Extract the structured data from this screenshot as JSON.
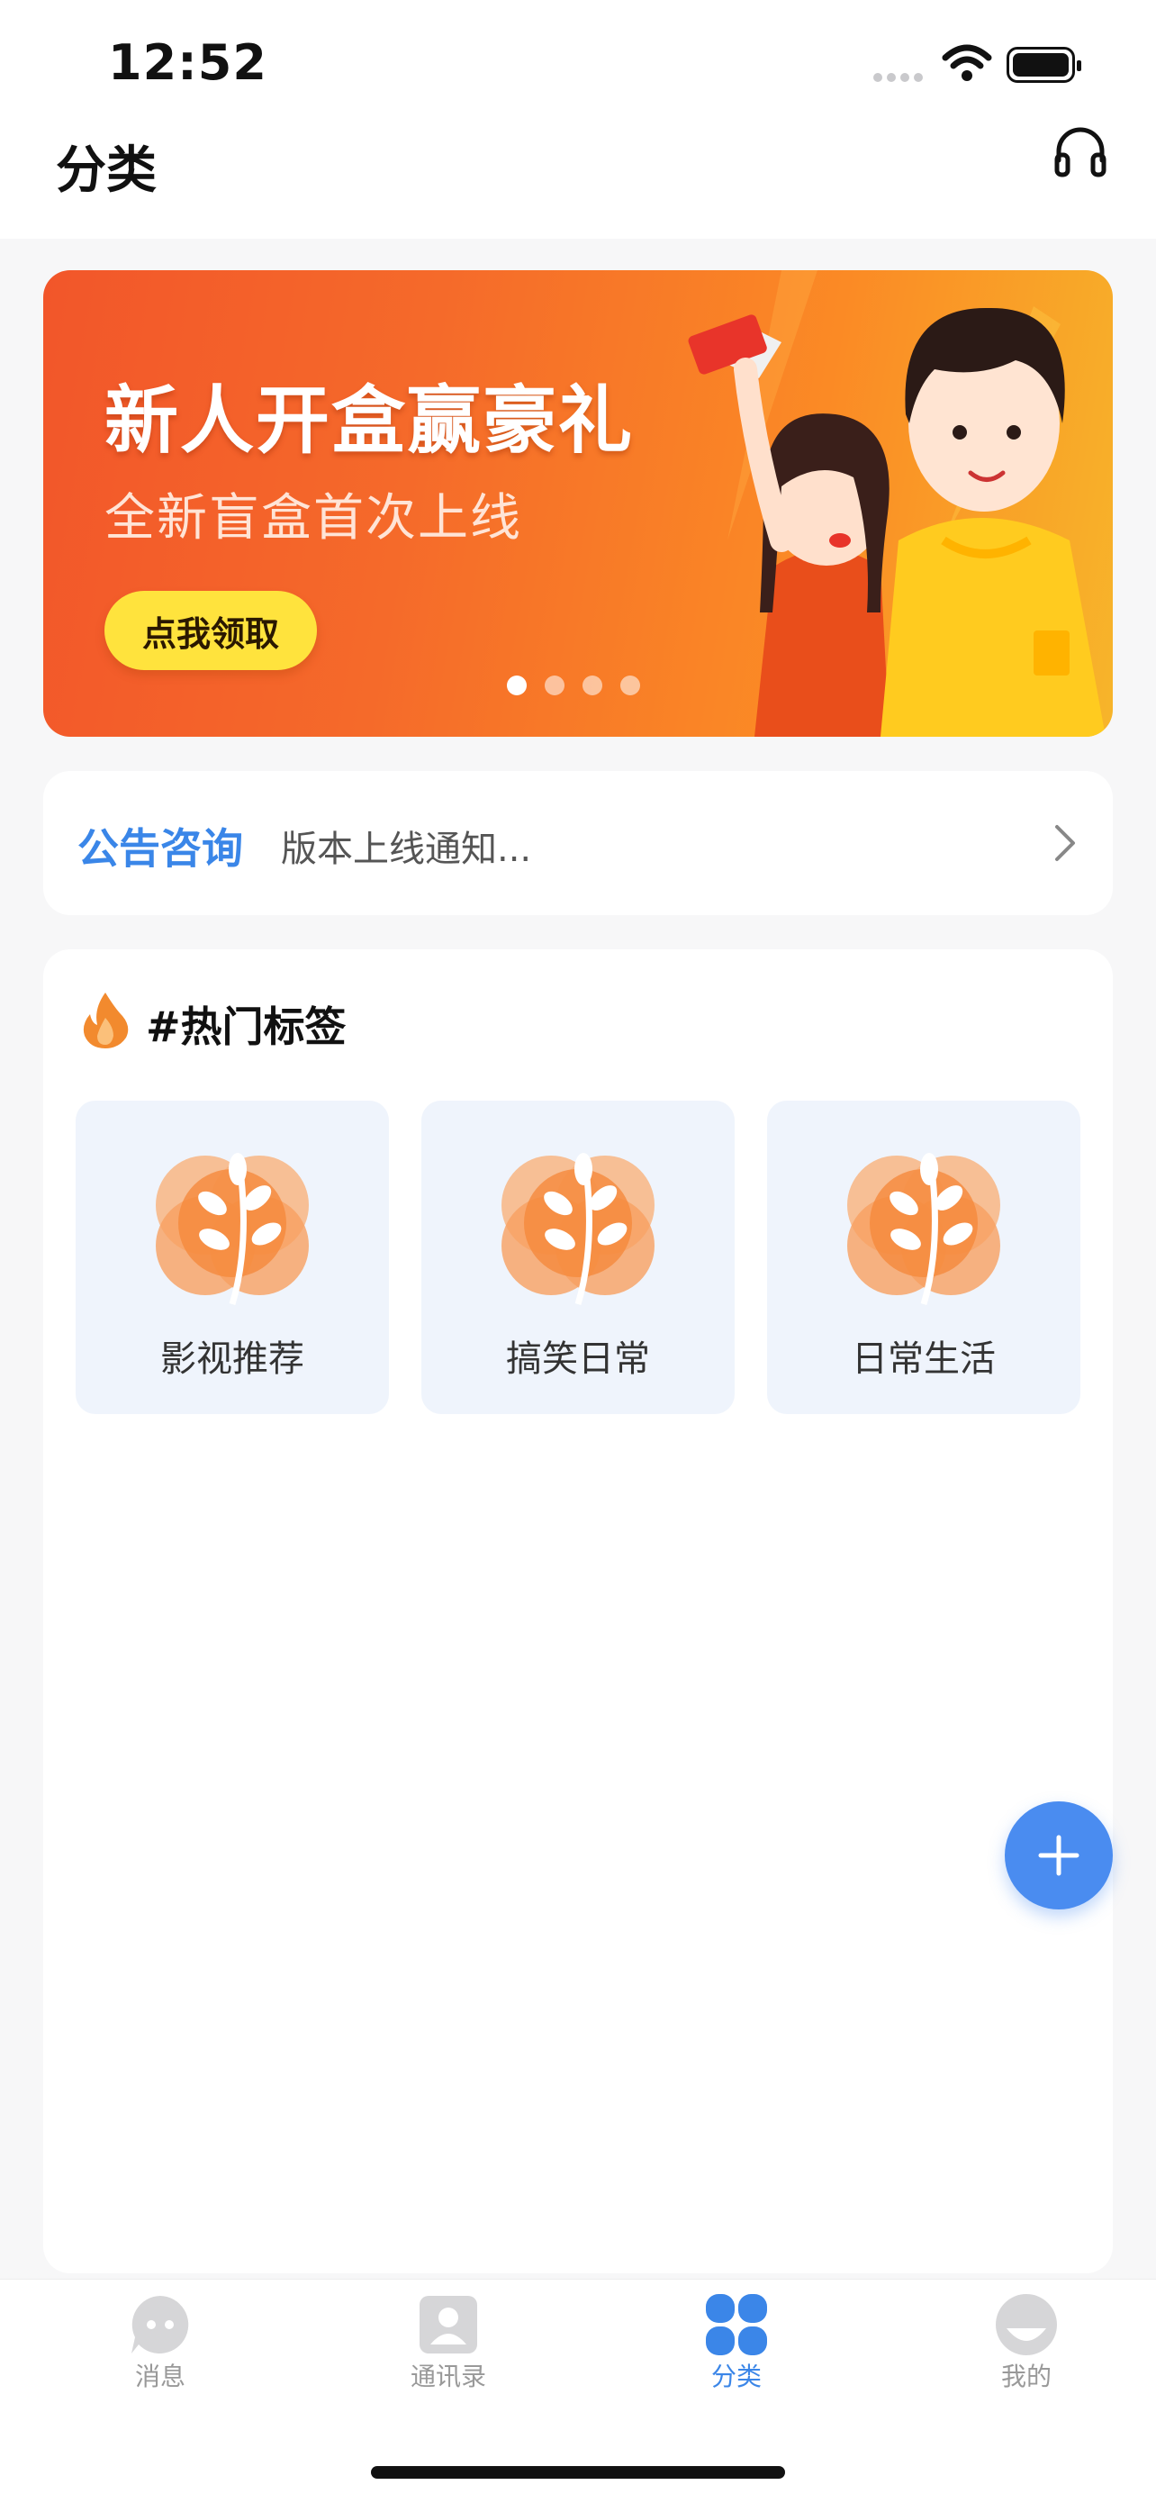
{
  "status_bar": {
    "time": "12:52"
  },
  "header": {
    "title": "分类"
  },
  "banner": {
    "title": "新人开盒赢豪礼",
    "subtitle": "全新盲盒首次上线",
    "button_label": "点我领取",
    "page_count": 4,
    "active_page": 1
  },
  "notice": {
    "label": "公告咨询",
    "text": "版本上线通知..."
  },
  "hot_tags": {
    "title": "#热门标签",
    "items": [
      {
        "label": "影视推荐"
      },
      {
        "label": "搞笑日常"
      },
      {
        "label": "日常生活"
      }
    ]
  },
  "tab_bar": {
    "items": [
      {
        "label": "消息",
        "icon": "message-icon"
      },
      {
        "label": "通讯录",
        "icon": "contacts-icon"
      },
      {
        "label": "分类",
        "icon": "category-icon"
      },
      {
        "label": "我的",
        "icon": "profile-icon"
      }
    ],
    "active": "分类"
  },
  "colors": {
    "accent": "#3b86e8",
    "banner_orange": "#f56a2a",
    "tag_background": "#eff4fc",
    "fab": "#4a8cf0"
  }
}
